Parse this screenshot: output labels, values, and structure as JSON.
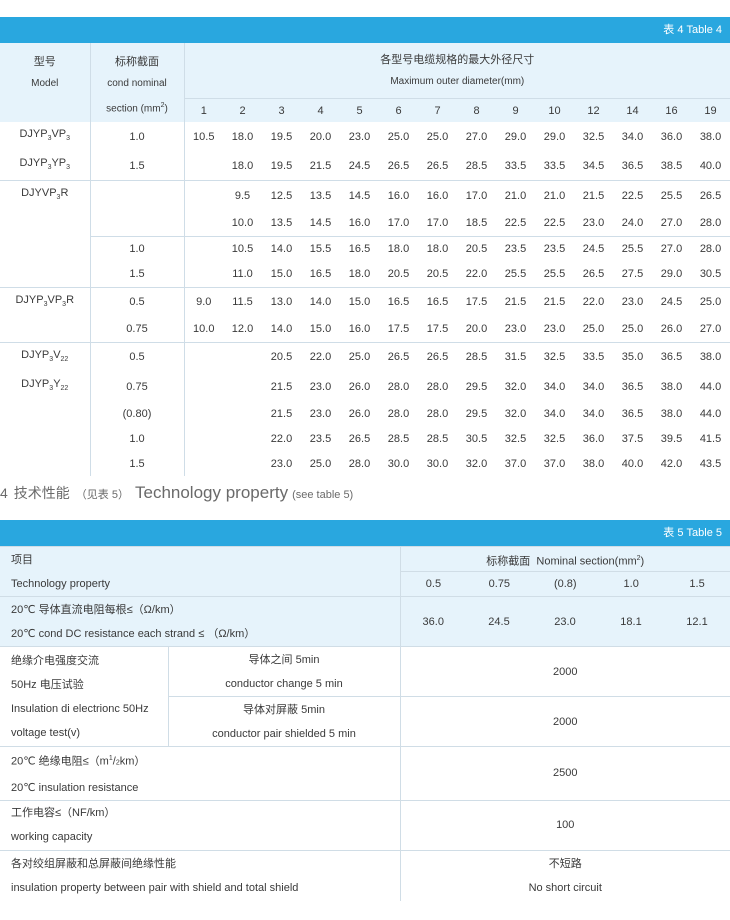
{
  "table4": {
    "caption": "表 4  Table 4",
    "col_model_cn": "型号",
    "col_model_en": "Model",
    "col_section_cn": "标称截面",
    "col_section_en1": "cond nominal",
    "col_section_en2": "section (mm²)",
    "col_diam_cn": "各型号电缆规格的最大外径尺寸",
    "col_diam_en": "Maximum outer diameter(mm)",
    "pairs": [
      "1",
      "2",
      "3",
      "4",
      "5",
      "6",
      "7",
      "8",
      "9",
      "10",
      "12",
      "14",
      "16",
      "19"
    ],
    "rows": [
      {
        "model": "DJYP3VP3",
        "section": "1.0",
        "values": [
          "10.5",
          "18.0",
          "19.5",
          "20.0",
          "23.0",
          "25.0",
          "25.0",
          "27.0",
          "29.0",
          "29.0",
          "32.5",
          "34.0",
          "36.0",
          "38.0"
        ]
      },
      {
        "model": "DJYP3YP3",
        "section": "1.5",
        "values": [
          "",
          "18.0",
          "19.5",
          "21.5",
          "24.5",
          "26.5",
          "26.5",
          "28.5",
          "33.5",
          "33.5",
          "34.5",
          "36.5",
          "38.5",
          "40.0"
        ]
      },
      {
        "model": "DJYVP3R",
        "section": "",
        "values": [
          "",
          "9.5",
          "12.5",
          "13.5",
          "14.5",
          "16.0",
          "16.0",
          "17.0",
          "21.0",
          "21.0",
          "21.5",
          "22.5",
          "25.5",
          "26.5"
        ]
      },
      {
        "model": "",
        "section": "",
        "values": [
          "",
          "10.0",
          "13.5",
          "14.5",
          "16.0",
          "17.0",
          "17.0",
          "18.5",
          "22.5",
          "22.5",
          "23.0",
          "24.0",
          "27.0",
          "28.0"
        ]
      },
      {
        "model": "",
        "section": "1.0",
        "values": [
          "",
          "10.5",
          "14.0",
          "15.5",
          "16.5",
          "18.0",
          "18.0",
          "20.5",
          "23.5",
          "23.5",
          "24.5",
          "25.5",
          "27.0",
          "28.0"
        ]
      },
      {
        "model": "",
        "section": "1.5",
        "values": [
          "",
          "11.0",
          "15.0",
          "16.5",
          "18.0",
          "20.5",
          "20.5",
          "22.0",
          "25.5",
          "25.5",
          "26.5",
          "27.5",
          "29.0",
          "30.5"
        ]
      },
      {
        "model": "DJYP3VP3R",
        "section": "0.5",
        "values": [
          "9.0",
          "11.5",
          "13.0",
          "14.0",
          "15.0",
          "16.5",
          "16.5",
          "17.5",
          "21.5",
          "21.5",
          "22.0",
          "23.0",
          "24.5",
          "25.0"
        ]
      },
      {
        "model": "",
        "section": "0.75",
        "values": [
          "10.0",
          "12.0",
          "14.0",
          "15.0",
          "16.0",
          "17.5",
          "17.5",
          "20.0",
          "23.0",
          "23.0",
          "25.0",
          "25.0",
          "26.0",
          "27.0"
        ]
      },
      {
        "model": "DJYP3V22",
        "section": "0.5",
        "values": [
          "",
          "",
          "20.5",
          "22.0",
          "25.0",
          "26.5",
          "26.5",
          "28.5",
          "31.5",
          "32.5",
          "33.5",
          "35.0",
          "36.5",
          "38.0"
        ]
      },
      {
        "model": "DJYP3Y22",
        "section": "0.75",
        "values": [
          "",
          "",
          "21.5",
          "23.0",
          "26.0",
          "28.0",
          "28.0",
          "29.5",
          "32.0",
          "34.0",
          "34.0",
          "36.5",
          "38.0",
          "44.0"
        ]
      },
      {
        "model": "",
        "section": "(0.80)",
        "values": [
          "",
          "",
          "21.5",
          "23.0",
          "26.0",
          "28.0",
          "28.0",
          "29.5",
          "32.0",
          "34.0",
          "34.0",
          "36.5",
          "38.0",
          "44.0"
        ]
      },
      {
        "model": "",
        "section": "1.0",
        "values": [
          "",
          "",
          "22.0",
          "23.5",
          "26.5",
          "28.5",
          "28.5",
          "30.5",
          "32.5",
          "32.5",
          "36.0",
          "37.5",
          "39.5",
          "41.5"
        ]
      },
      {
        "model": "",
        "section": "1.5",
        "values": [
          "",
          "",
          "23.0",
          "25.0",
          "28.0",
          "30.0",
          "30.0",
          "32.0",
          "37.0",
          "37.0",
          "38.0",
          "40.0",
          "42.0",
          "43.5"
        ]
      }
    ]
  },
  "section4": {
    "number": "4",
    "title_cn": "技术性能",
    "note_cn": "（见表 5）",
    "title_en": "Technology property",
    "note_en": "(see table 5)"
  },
  "table5": {
    "caption": "表 5  Table 5",
    "item_cn": "项目",
    "item_en": "Technology property",
    "nominal_header": "标称截面  Nominal section(mm²)",
    "sections": [
      "0.5",
      "0.75",
      "(0.8)",
      "1.0",
      "1.5"
    ],
    "resistance_cn": "20℃ 导体直流电阻每根≤（Ω/km）",
    "resistance_en": "20℃  cond DC resistance each strand  ≤ （Ω/km）",
    "resistance_values": [
      "36.0",
      "24.5",
      "23.0",
      "18.1",
      "12.1"
    ],
    "dielectric_cn1": "绝缘介电强度交流",
    "dielectric_cn2": "50Hz 电压试验",
    "dielectric_en1": "Insulation di electrionc 50Hz",
    "dielectric_en2": "voltage test(v)",
    "between_conductor_cn": "导体之间 5min",
    "between_conductor_en": "conductor change 5 min",
    "conductor_shield_cn": "导体对屏蔽 5min",
    "conductor_shield_en": "conductor pair shielded 5 min",
    "dielectric_value1": "2000",
    "dielectric_value2": "2000",
    "insulation_res_cn": "20℃ 绝缘电阻≤（m²/·km）",
    "insulation_res_en": "20℃  insulation resistance",
    "insulation_res_value": "2500",
    "capacity_cn": "工作电容≤（NF/km）",
    "capacity_en": "working capacity",
    "capacity_value": "100",
    "shield_cn": "各对绞组屏蔽和总屏蔽间绝缘性能",
    "shield_en": "insulation property between pair with shield and total shield",
    "shield_value_cn": "不短路",
    "shield_value_en": "No short circuit"
  }
}
